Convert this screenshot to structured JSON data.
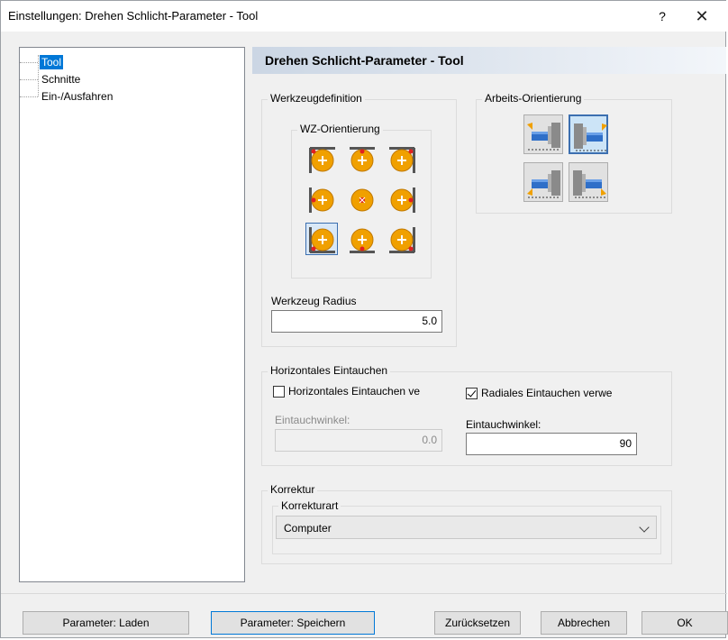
{
  "window": {
    "title": "Einstellungen: Drehen Schlicht-Parameter - Tool",
    "help": "?",
    "close": "✕"
  },
  "tree": {
    "items": [
      {
        "label": "Tool",
        "selected": true
      },
      {
        "label": "Schnitte",
        "selected": false
      },
      {
        "label": "Ein-/Ausfahren",
        "selected": false
      }
    ]
  },
  "header": {
    "title": "Drehen Schlicht-Parameter - Tool"
  },
  "werkzeugdefinition": {
    "label": "Werkzeugdefinition",
    "wz_orientierung": {
      "label": "WZ-Orientierung",
      "selected_index": 6,
      "icons": [
        "tool-orient-top-left-icon",
        "tool-orient-top-center-icon",
        "tool-orient-top-right-icon",
        "tool-orient-middle-left-icon",
        "tool-orient-center-icon",
        "tool-orient-middle-right-icon",
        "tool-orient-bottom-left-icon",
        "tool-orient-bottom-center-icon",
        "tool-orient-bottom-right-icon"
      ]
    },
    "radius_label": "Werkzeug Radius",
    "radius_value": "5.0"
  },
  "arbeits_orientierung": {
    "label": "Arbeits-Orientierung",
    "selected_index": 1,
    "icons": [
      "work-orient-right-up-icon",
      "work-orient-left-up-icon",
      "work-orient-right-down-icon",
      "work-orient-left-down-icon"
    ]
  },
  "horizontales_eintauchen": {
    "label": "Horizontales Eintauchen",
    "horizontal_check_label": "Horizontales Eintauchen ve",
    "horizontal_checked": false,
    "radial_check_label": "Radiales Eintauchen verwe",
    "radial_checked": true,
    "left_angle_label": "Eintauchwinkel:",
    "left_angle_value": "0.0",
    "right_angle_label": "Eintauchwinkel:",
    "right_angle_value": "90"
  },
  "korrektur": {
    "label": "Korrektur",
    "art_label": "Korrekturart",
    "art_value": "Computer"
  },
  "buttons": {
    "laden": "Parameter: Laden",
    "speichern": "Parameter: Speichern",
    "zuruecksetzen": "Zurücksetzen",
    "abbrechen": "Abbrechen",
    "ok": "OK"
  },
  "colors": {
    "accent": "#0078d7",
    "tool_orange": "#f0a000",
    "marker_red": "#e02020"
  }
}
